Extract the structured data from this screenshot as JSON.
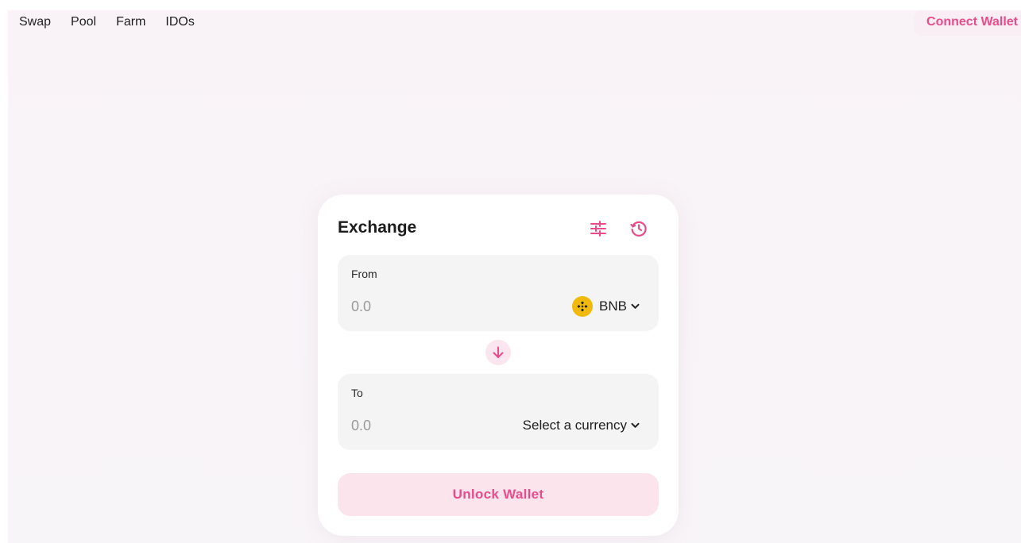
{
  "nav": {
    "items": [
      {
        "label": "Swap"
      },
      {
        "label": "Pool"
      },
      {
        "label": "Farm"
      },
      {
        "label": "IDOs"
      }
    ],
    "connect_label": "Connect Wallet"
  },
  "exchange": {
    "title": "Exchange",
    "settings_icon": "settings-sliders-icon",
    "history_icon": "history-icon",
    "from": {
      "label": "From",
      "amount_placeholder": "0.0",
      "currency": "BNB",
      "currency_icon": "bnb-logo"
    },
    "switch_icon": "arrow-down-icon",
    "to": {
      "label": "To",
      "amount_placeholder": "0.0",
      "currency": "Select a currency"
    },
    "unlock_label": "Unlock Wallet"
  },
  "colors": {
    "accent": "#ea4b8b",
    "accent_soft": "#fbe4ec",
    "panel_bg": "#f4f4f4",
    "bnb": "#f0b90b",
    "page_bg": "#f9f3f7"
  }
}
